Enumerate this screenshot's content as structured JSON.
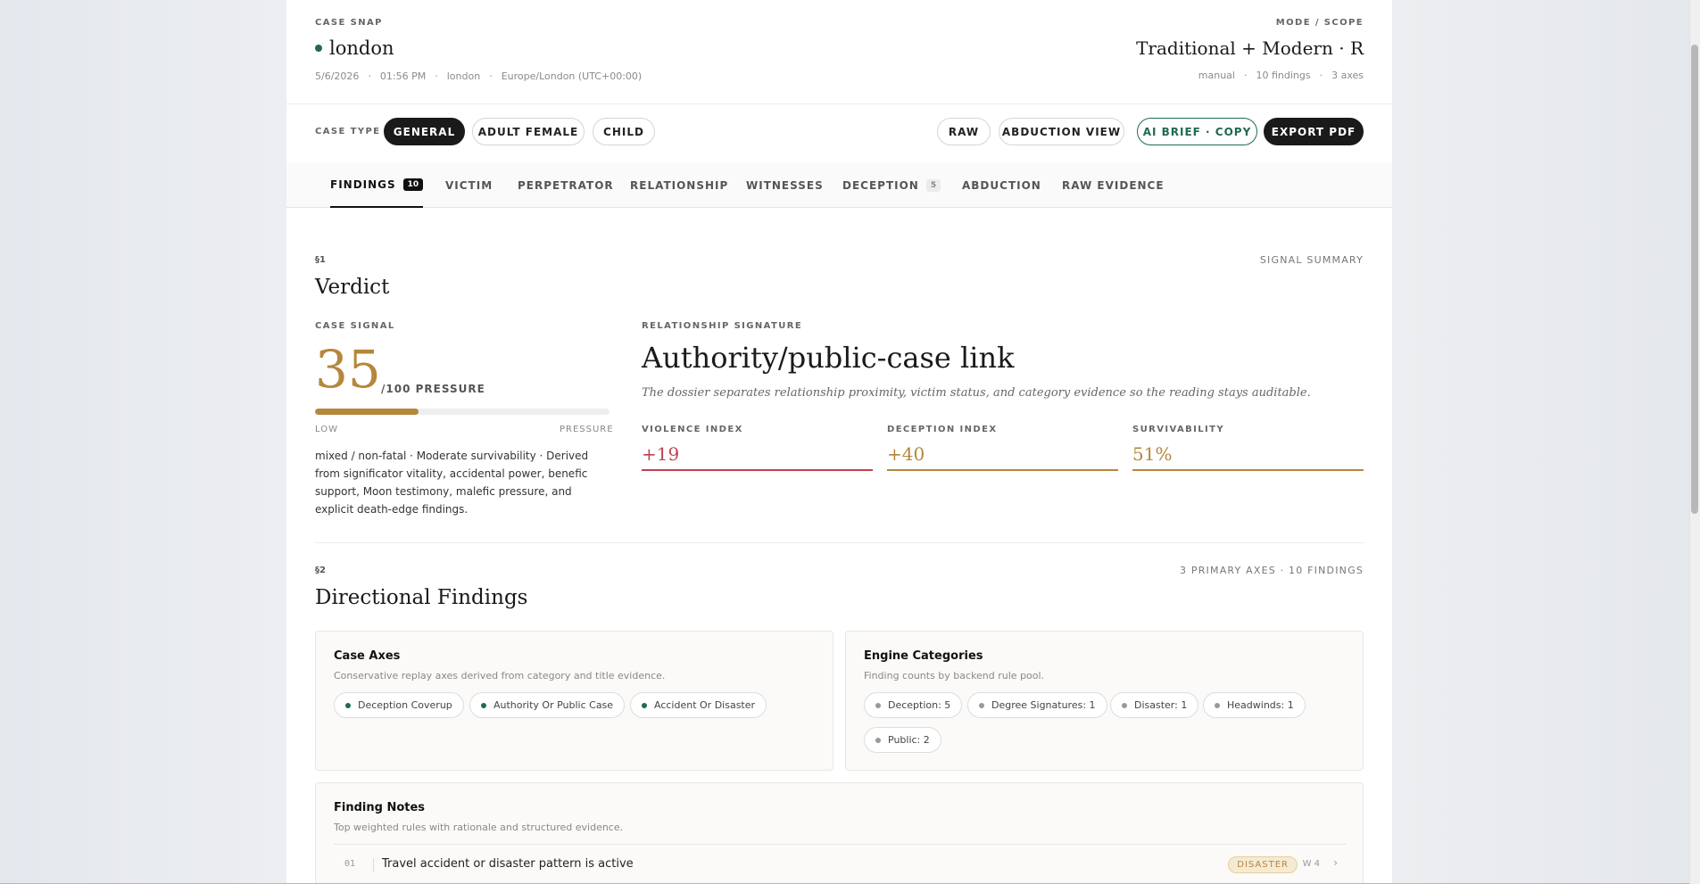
{
  "header": {
    "eyebrow_left": "CASE SNAP",
    "city": "london",
    "date": "5/6/2026",
    "time": "01:56 PM",
    "location": "london",
    "timezone": "Europe/London (UTC+00:00)",
    "eyebrow_right": "MODE / SCOPE",
    "mode": "Traditional + Modern · R",
    "meta_source": "manual",
    "meta_findings": "10 findings",
    "meta_axes": "3 axes"
  },
  "case_type": {
    "label": "CASE TYPE",
    "options": [
      "GENERAL",
      "ADULT FEMALE",
      "CHILD"
    ],
    "selected": "GENERAL"
  },
  "actions": {
    "raw": "RAW",
    "abduction_view": "ABDUCTION VIEW",
    "ai_brief": "AI BRIEF · COPY",
    "export_pdf": "EXPORT PDF"
  },
  "tabs": [
    {
      "label": "FINDINGS",
      "badge": "10"
    },
    {
      "label": "VICTIM"
    },
    {
      "label": "PERPETRATOR"
    },
    {
      "label": "RELATIONSHIP"
    },
    {
      "label": "WITNESSES"
    },
    {
      "label": "DECEPTION",
      "badge": "5"
    },
    {
      "label": "ABDUCTION"
    },
    {
      "label": "RAW EVIDENCE"
    }
  ],
  "verdict": {
    "section_num": "§1",
    "title": "Verdict",
    "right_label": "SIGNAL SUMMARY",
    "case_signal_label": "CASE SIGNAL",
    "score": "35",
    "score_suffix": "/100 PRESSURE",
    "score_fraction": 0.35,
    "scale_low": "LOW",
    "scale_high": "PRESSURE",
    "description": "mixed / non-fatal · Moderate survivability · Derived from significator vitality, accidental power, benefic support, Moon testimony, malefic pressure, and explicit death-edge findings.",
    "relationship_label": "RELATIONSHIP SIGNATURE",
    "relationship_title": "Authority/public-case link",
    "relationship_sub": "The dossier separates relationship proximity, victim status, and category evidence so the reading stays auditable.",
    "violence_label": "VIOLENCE INDEX",
    "violence_value": "+19",
    "deception_label": "DECEPTION INDEX",
    "deception_value": "+40",
    "survivability_label": "SURVIVABILITY",
    "survivability_value": "51%"
  },
  "findings": {
    "section_num": "§2",
    "title": "Directional Findings",
    "right_label": "3 PRIMARY AXES · 10 FINDINGS",
    "axes_card": {
      "title": "Case Axes",
      "desc": "Conservative replay axes derived from category and title evidence.",
      "chips": [
        "Deception Coverup",
        "Authority Or Public Case",
        "Accident Or Disaster"
      ]
    },
    "engine_card": {
      "title": "Engine Categories",
      "desc": "Finding counts by backend rule pool.",
      "chips": [
        "Deception: 5",
        "Degree Signatures: 1",
        "Disaster: 1",
        "Headwinds: 1",
        "Public: 2"
      ]
    },
    "notes_card": {
      "title": "Finding Notes",
      "desc": "Top weighted rules with rationale and structured evidence.",
      "rows": [
        {
          "num": "01",
          "text": "Travel accident or disaster pattern is active",
          "tag": "DISASTER",
          "weight": "W 4"
        }
      ]
    }
  },
  "colors": {
    "accent_gold": "#b5873a",
    "accent_red": "#c0414e",
    "accent_green": "#1f6b4e",
    "dark": "#1a1a1a"
  }
}
